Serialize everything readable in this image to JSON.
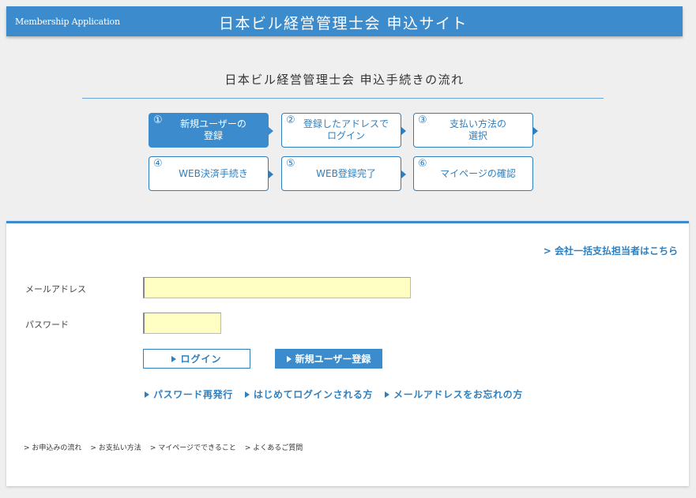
{
  "header": {
    "app_label": "Membership Application",
    "site_title": "日本ビル経営管理士会 申込サイト",
    "background_color": "#3c8ccd"
  },
  "flow": {
    "title": "日本ビル経営管理士会 申込手続きの流れ",
    "steps": [
      {
        "num": "①",
        "label": "新規ユーザーの\n登録",
        "active": true
      },
      {
        "num": "②",
        "label": "登録したアドレスで\nログイン",
        "active": false
      },
      {
        "num": "③",
        "label": "支払い方法の\n選択",
        "active": false
      },
      {
        "num": "④",
        "label": "WEB決済手続き",
        "active": false
      },
      {
        "num": "⑤",
        "label": "WEB登録完了",
        "active": false
      },
      {
        "num": "⑥",
        "label": "マイページの確認",
        "active": false
      }
    ]
  },
  "form": {
    "corporate_link": "> 会社一括支払担当者はこちら",
    "email_label": "メールアドレス",
    "email_value": "",
    "password_label": "パスワード",
    "password_value": "",
    "login_button": "ログイン",
    "register_button": "新規ユーザー登録",
    "help_links": [
      "パスワード再発行",
      "はじめてログインされる方",
      "メールアドレスをお忘れの方"
    ]
  },
  "footer": {
    "links": [
      "> お申込みの流れ",
      "> お支払い方法",
      "> マイページでできること",
      "> よくあるご質問"
    ]
  }
}
